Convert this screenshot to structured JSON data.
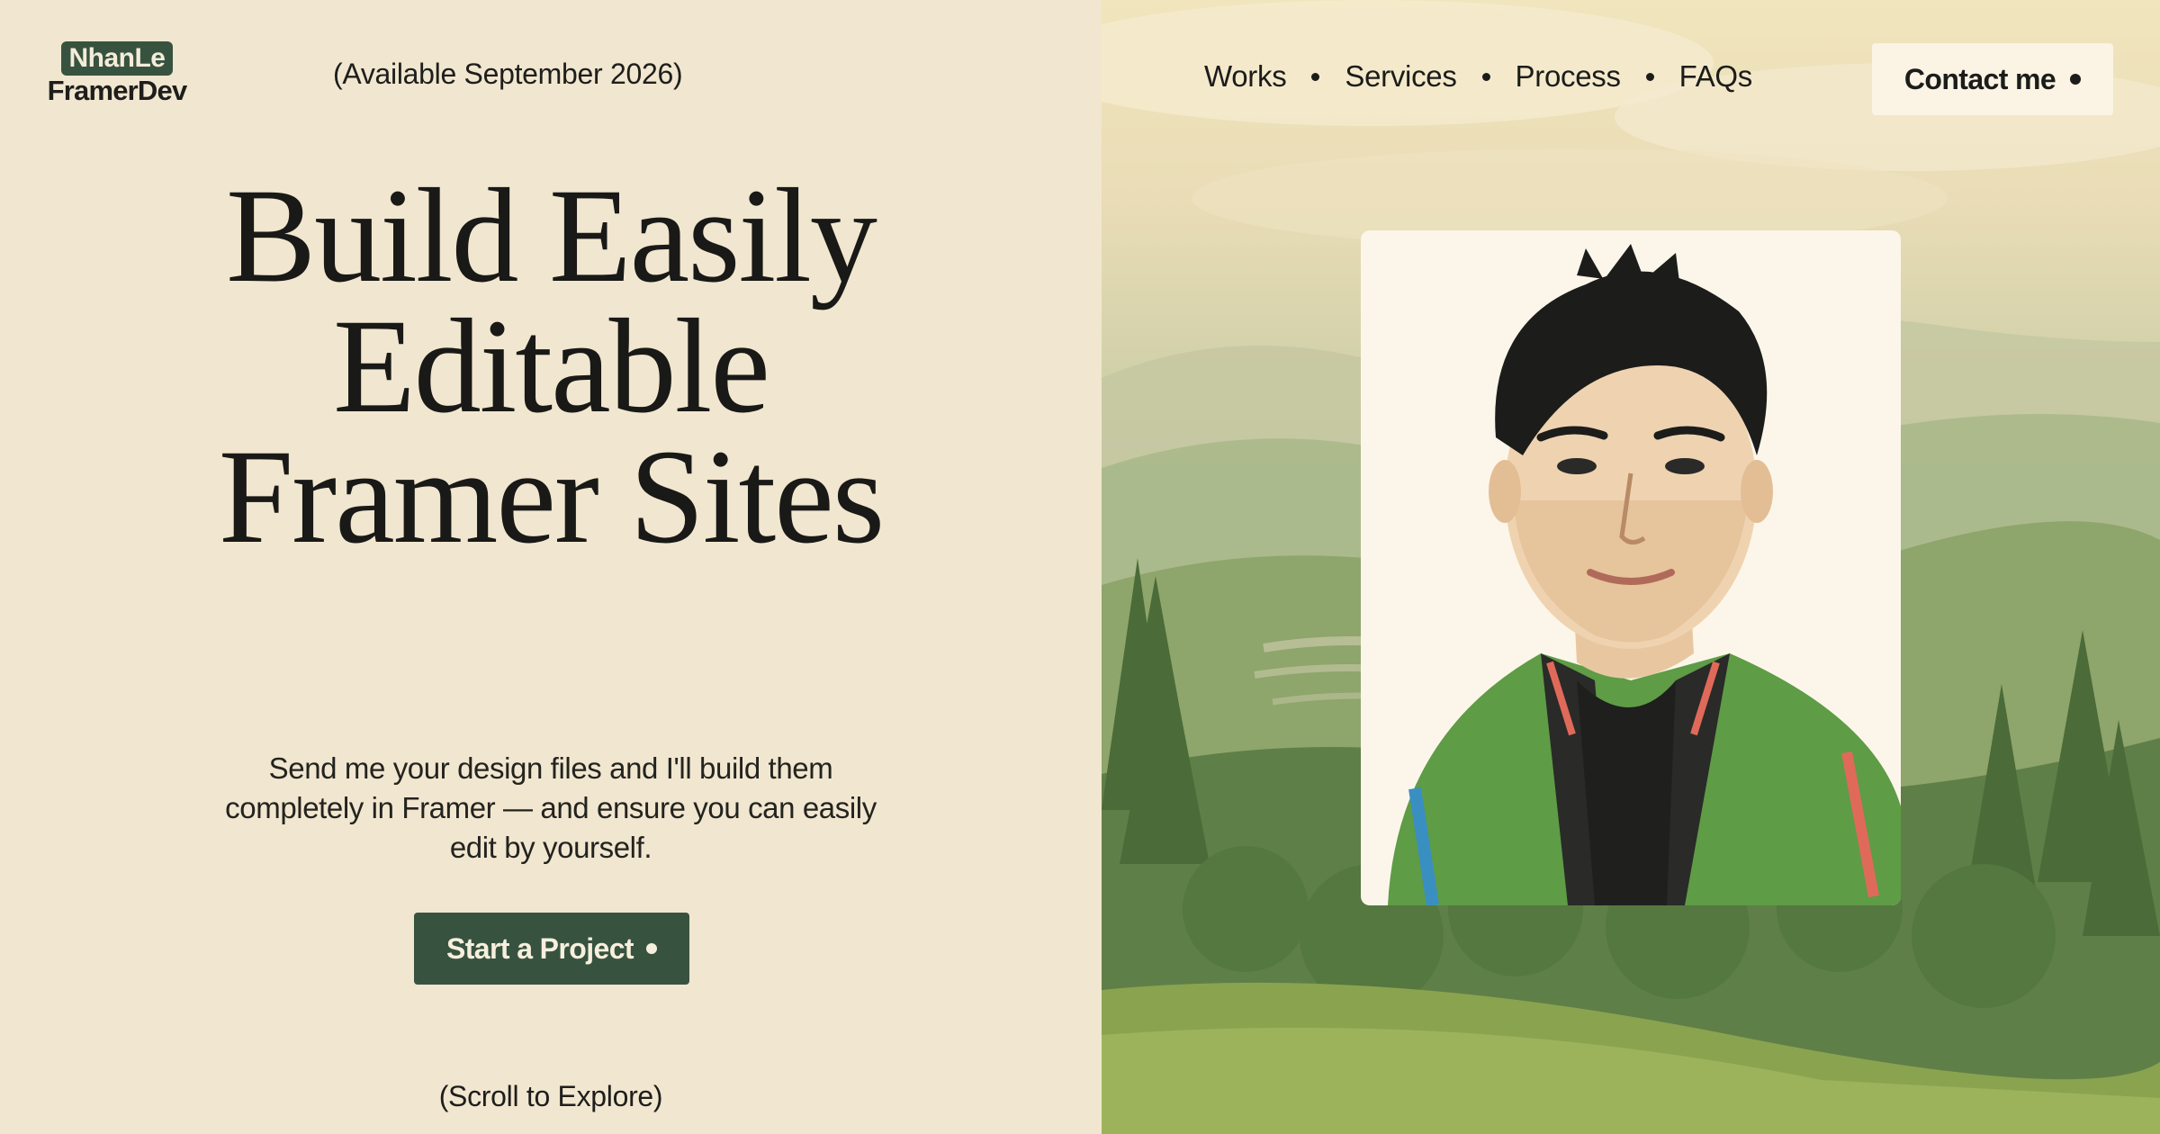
{
  "brand": {
    "line1": "NhanLe",
    "line2": "FramerDev"
  },
  "availability": "(Available September 2026)",
  "hero": {
    "headline": [
      "Build Easily",
      "Editable",
      "Framer Sites"
    ],
    "description": "Send me your design files and I'll build them completely in Framer — and ensure you can easily edit by yourself.",
    "cta_label": "Start a Project",
    "scroll_hint": "(Scroll to Explore)"
  },
  "nav": {
    "items": [
      {
        "label": "Works"
      },
      {
        "label": "Services"
      },
      {
        "label": "Process"
      },
      {
        "label": "FAQs"
      }
    ],
    "contact_label": "Contact me"
  },
  "portrait": {
    "subject": "illustrated-portrait",
    "jacket_color": "#5e9c46"
  },
  "colors": {
    "background": "#f1e6cf",
    "accent": "#37533f",
    "text": "#1c1c1a",
    "card": "#fcf6ea"
  },
  "icons": {
    "button_dot": "dot-icon",
    "nav_separator": "dot-separator-icon"
  }
}
